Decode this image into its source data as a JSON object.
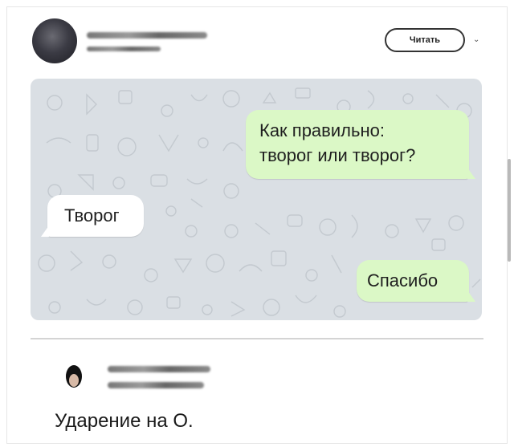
{
  "post": {
    "follow_label": "Читать",
    "menu_icon": "chevron-down-icon"
  },
  "chat": {
    "messages": [
      {
        "side": "outgoing",
        "text_line1": "Как правильно:",
        "text_line2": "творог или творог?"
      },
      {
        "side": "incoming",
        "text": "Творог"
      },
      {
        "side": "outgoing",
        "text": "Спасибо"
      }
    ]
  },
  "reply": {
    "text": "Ударение на О."
  },
  "colors": {
    "outgoing_bubble": "#dbf8c6",
    "incoming_bubble": "#ffffff",
    "chat_background": "#dadfe4"
  }
}
